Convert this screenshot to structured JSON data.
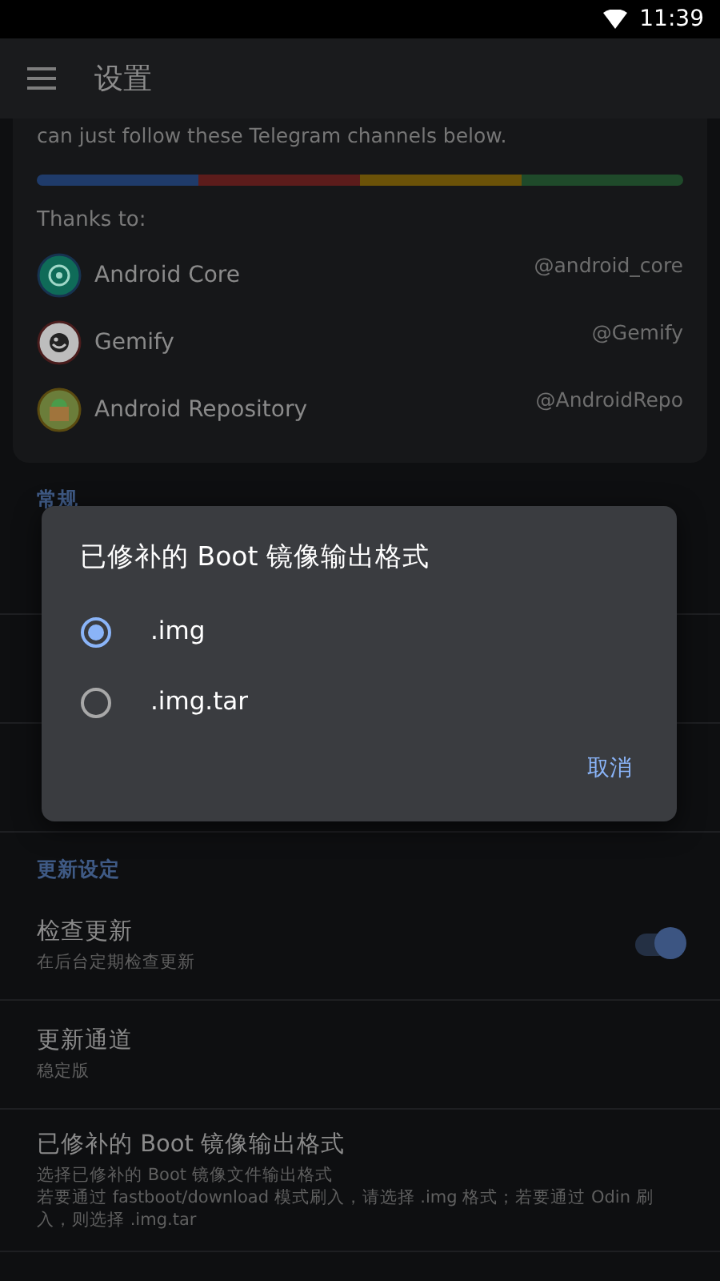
{
  "status_bar": {
    "time": "11:39"
  },
  "app_bar": {
    "title": "设置"
  },
  "card": {
    "text": "can just follow these Telegram channels below.",
    "thanks_label": "Thanks to:",
    "channels": [
      {
        "name": "Android Core",
        "handle": "@android_core",
        "kind": "core"
      },
      {
        "name": "Gemify",
        "handle": "@Gemify",
        "kind": "gemify"
      },
      {
        "name": "Android Repository",
        "handle": "@AndroidRepo",
        "kind": "repo"
      }
    ]
  },
  "sections": [
    {
      "header": "常规",
      "rows": [
        {
          "kind": "hidden"
        },
        {
          "kind": "hidden"
        },
        {
          "kind": "hidden"
        }
      ]
    },
    {
      "header": "更新设定",
      "rows": [
        {
          "kind": "switch",
          "title": "检查更新",
          "subtitle": "在后台定期检查更新",
          "on": true
        },
        {
          "kind": "plain",
          "title": "更新通道",
          "subtitle": "稳定版"
        },
        {
          "kind": "plain",
          "title": "已修补的 Boot 镜像输出格式",
          "subtitle_lines": [
            "选择已修补的 Boot 镜像文件输出格式",
            "若要通过 fastboot/download 模式刷入，请选择 .img 格式；若要通过 Odin 刷入，则选择 .img.tar"
          ]
        }
      ]
    }
  ],
  "dialog": {
    "title": "已修补的 Boot 镜像输出格式",
    "options": [
      {
        "label": ".img",
        "selected": true
      },
      {
        "label": ".img.tar",
        "selected": false
      }
    ],
    "button": "取消"
  }
}
